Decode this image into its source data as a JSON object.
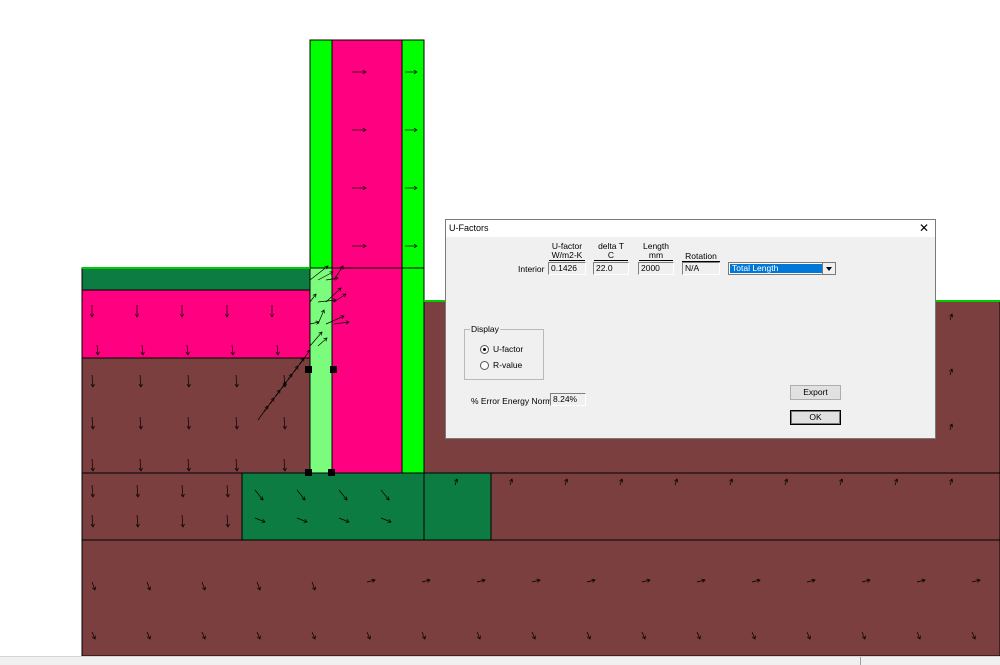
{
  "dialog": {
    "title": "U-Factors",
    "close_glyph": "✕",
    "columns": {
      "ufactor": {
        "name": "U-factor",
        "unit": "W/m2-K"
      },
      "deltaT": {
        "name": "delta T",
        "unit": "C"
      },
      "length": {
        "name": "Length",
        "unit": "mm"
      },
      "rotation": {
        "name": "Rotation"
      }
    },
    "row": {
      "label": "Interior",
      "ufactor": "0.1426",
      "deltaT": "22.0",
      "length": "2000",
      "rotation": "N/A"
    },
    "length_mode": {
      "selected": "Total Length"
    },
    "display_group": {
      "label": "Display",
      "options": [
        {
          "label": "U-factor",
          "selected": true
        },
        {
          "label": "R-value",
          "selected": false
        }
      ]
    },
    "error": {
      "label": "% Error Energy Norm",
      "value": "8.24%"
    },
    "buttons": {
      "export": "Export",
      "ok": "OK"
    }
  },
  "colors": {
    "soil": "#7b3f3f",
    "insulation_magenta": "#ff0080",
    "bright_green": "#00ff00",
    "dark_green": "#0c7c42",
    "light_green": "#7cfc7c",
    "dialog_bg": "#f0f0f0",
    "selection_blue": "#0078d7"
  },
  "icons": [
    "close-icon",
    "dropdown-arrow-icon",
    "flux-vector-arrow-icon"
  ]
}
